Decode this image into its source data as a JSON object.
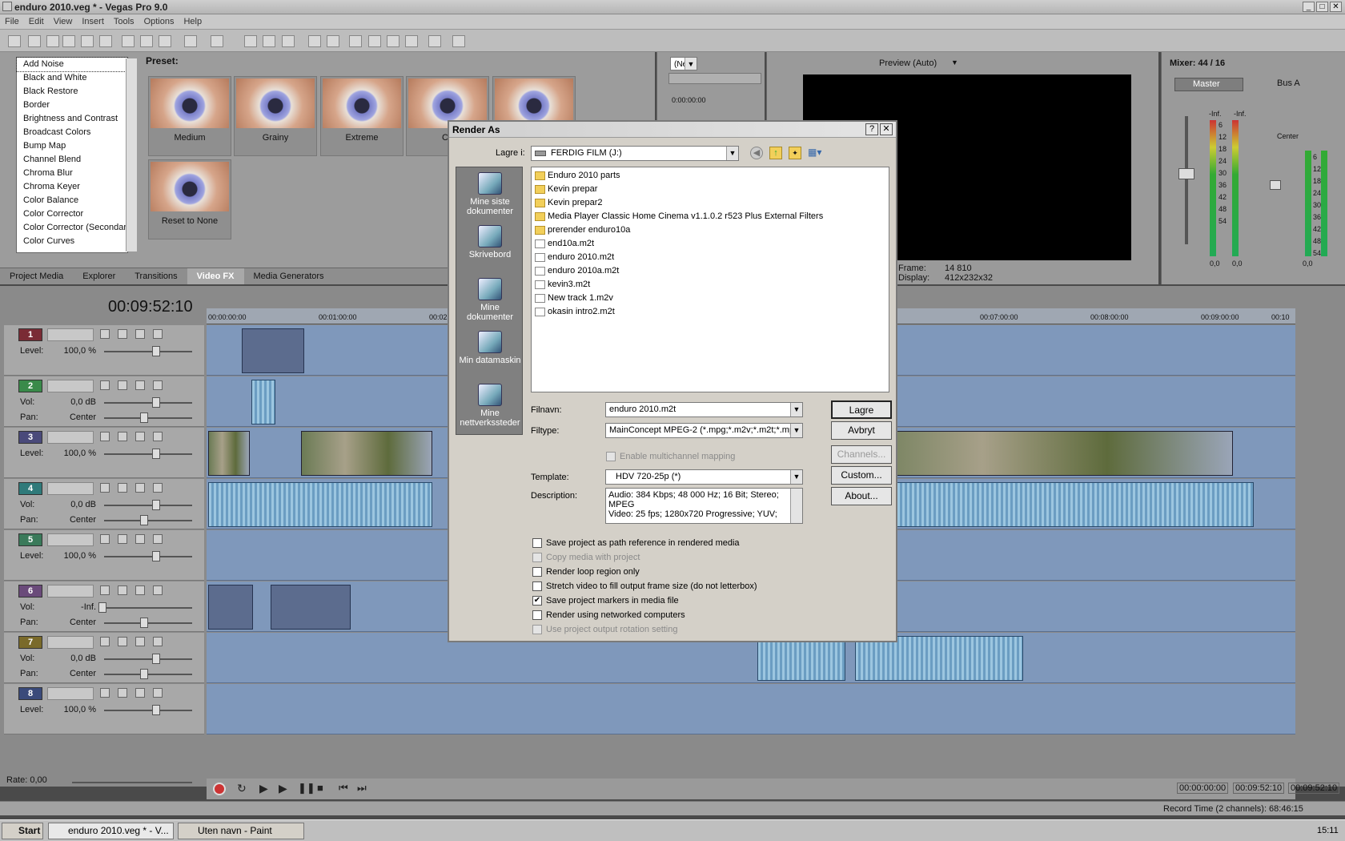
{
  "window": {
    "title": "enduro 2010.veg * - Vegas Pro 9.0"
  },
  "menu": [
    "File",
    "Edit",
    "View",
    "Insert",
    "Tools",
    "Options",
    "Help"
  ],
  "fx": {
    "items": [
      "Add Noise",
      "Black and White",
      "Black Restore",
      "Border",
      "Brightness and Contrast",
      "Broadcast Colors",
      "Bump Map",
      "Channel Blend",
      "Chroma Blur",
      "Chroma Keyer",
      "Color Balance",
      "Color Corrector",
      "Color Corrector (Secondary)",
      "Color Curves"
    ],
    "preset_label": "Preset:",
    "presets": [
      "Medium",
      "Grainy",
      "Extreme",
      "Co",
      "",
      "Reset to None"
    ]
  },
  "tabs": [
    "Project Media",
    "Explorer",
    "Transitions",
    "Video FX",
    "Media Generators"
  ],
  "trimmer": {
    "zoom": "(Ne",
    "time": "0:00:00:00"
  },
  "preview": {
    "mode": "Preview (Auto)",
    "frame_label": "Frame:",
    "frame": "14 810",
    "display_label": "Display:",
    "display": "412x232x32",
    "left1": "0p",
    "left2": "p"
  },
  "mixer": {
    "title": "Mixer: 44 / 16",
    "master": "Master",
    "bus": "Bus A",
    "center": "Center",
    "inf": "-Inf.",
    "levels": [
      "6",
      "12",
      "18",
      "24",
      "30",
      "36",
      "42",
      "48",
      "54"
    ],
    "vals": [
      "0,0",
      "0,0",
      "0,0"
    ]
  },
  "timeline": {
    "timecode": "00:09:52:10",
    "ruler": [
      "00:00:00:00",
      "00:01:00:00",
      "00:02",
      "00",
      "00:07:00:00",
      "00:08:00:00",
      "00:09:00:00",
      "00:10"
    ],
    "tracks": [
      {
        "n": "1",
        "color": "#7a2b35",
        "rows": [
          [
            "Level:",
            "100,0 %"
          ]
        ]
      },
      {
        "n": "2",
        "color": "#3a8a4a",
        "rows": [
          [
            "Vol:",
            "0,0 dB"
          ],
          [
            "Pan:",
            "Center"
          ]
        ]
      },
      {
        "n": "3",
        "color": "#4a4a7a",
        "rows": [
          [
            "Level:",
            "100,0 %"
          ]
        ]
      },
      {
        "n": "4",
        "color": "#2f7a7a",
        "rows": [
          [
            "Vol:",
            "0,0 dB"
          ],
          [
            "Pan:",
            "Center"
          ]
        ]
      },
      {
        "n": "5",
        "color": "#3a7a5a",
        "rows": [
          [
            "Level:",
            "100,0 %"
          ]
        ]
      },
      {
        "n": "6",
        "color": "#6a4a7a",
        "rows": [
          [
            "Vol:",
            "-Inf."
          ],
          [
            "Pan:",
            "Center"
          ]
        ]
      },
      {
        "n": "7",
        "color": "#7a6a2a",
        "rows": [
          [
            "Vol:",
            "0,0 dB"
          ],
          [
            "Pan:",
            "Center"
          ]
        ]
      },
      {
        "n": "8",
        "color": "#3a4a7a",
        "rows": [
          [
            "Level:",
            "100,0 %"
          ]
        ]
      }
    ],
    "rate": "Rate: 0,00",
    "tc1": "00:00:00:00",
    "tc2": "00:09:52:10",
    "tc3": "00:09:52:10",
    "record": "Record Time (2 channels): 68:46:15"
  },
  "dialog": {
    "title": "Render As",
    "help": "?",
    "close": "✕",
    "save_in_label": "Lagre i:",
    "save_in": "FERDIG FILM (J:)",
    "places": [
      "Mine siste dokumenter",
      "Skrivebord",
      "Mine dokumenter",
      "Min datamaskin",
      "Mine nettverkssteder"
    ],
    "files": [
      {
        "name": "Enduro 2010 parts",
        "type": "folder"
      },
      {
        "name": "Kevin prepar",
        "type": "folder"
      },
      {
        "name": "Kevin prepar2",
        "type": "folder"
      },
      {
        "name": "Media Player Classic Home Cinema v1.1.0.2 r523 Plus External Filters",
        "type": "folder"
      },
      {
        "name": "prerender enduro10a",
        "type": "folder"
      },
      {
        "name": "end10a.m2t",
        "type": "file"
      },
      {
        "name": "enduro 2010.m2t",
        "type": "file"
      },
      {
        "name": "enduro 2010a.m2t",
        "type": "file"
      },
      {
        "name": "kevin3.m2t",
        "type": "file"
      },
      {
        "name": "New track 1.m2v",
        "type": "file"
      },
      {
        "name": "okasin intro2.m2t",
        "type": "file"
      }
    ],
    "filename_label": "Filnavn:",
    "filename": "enduro 2010.m2t",
    "filetype_label": "Filtype:",
    "filetype": "MainConcept MPEG-2 (*.mpg;*.m2v;*.m2t;*.mpa",
    "multichannel": "Enable multichannel mapping",
    "template_label": "Template:",
    "template": "HDV 720-25p (*)",
    "description_label": "Description:",
    "description": "Audio: 384 Kbps; 48 000 Hz; 16 Bit; Stereo; MPEG\nVideo: 25 fps; 1280x720 Progressive; YUV;",
    "buttons": {
      "save": "Lagre",
      "cancel": "Avbryt",
      "channels": "Channels...",
      "custom": "Custom...",
      "about": "About..."
    },
    "options": [
      {
        "label": "Save project as path reference in rendered media",
        "checked": false,
        "enabled": true
      },
      {
        "label": "Copy media with project",
        "checked": false,
        "enabled": false
      },
      {
        "label": "Render loop region only",
        "checked": false,
        "enabled": true
      },
      {
        "label": "Stretch video to fill output frame size (do not letterbox)",
        "checked": false,
        "enabled": true
      },
      {
        "label": "Save project markers in media file",
        "checked": true,
        "enabled": true
      },
      {
        "label": "Render using networked computers",
        "checked": false,
        "enabled": true
      },
      {
        "label": "Use project output rotation setting",
        "checked": false,
        "enabled": false
      }
    ]
  },
  "taskbar": {
    "start": "Start",
    "items": [
      "enduro 2010.veg * - V...",
      "Uten navn - Paint"
    ],
    "clock": "15:11"
  }
}
